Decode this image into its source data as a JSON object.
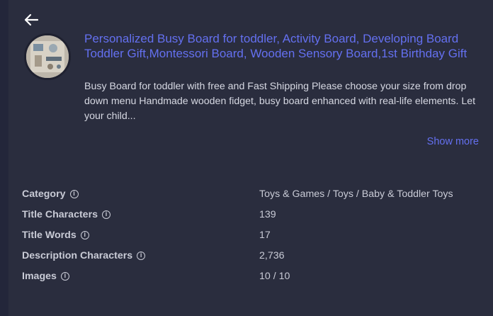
{
  "nav": {
    "back_icon": "arrow-left-icon"
  },
  "product": {
    "thumbnail": "busy-board-product-photo",
    "title": "Personalized Busy Board for toddler, Activity Board, Developing Board Toddler Gift,Montessori Board, Wooden Sensory Board,1st Birthday Gift",
    "description": "Busy Board for toddler with free and Fast Shipping Please choose your size from drop down menu Handmade wooden fidget, busy board enhanced with real-life elements. Let your child...",
    "show_more_label": "Show more"
  },
  "specs": [
    {
      "label": "Category",
      "value": "Toys & Games / Toys / Baby & Toddler Toys"
    },
    {
      "label": "Title Characters",
      "value": "139"
    },
    {
      "label": "Title Words",
      "value": "17"
    },
    {
      "label": "Description Characters",
      "value": "2,736"
    },
    {
      "label": "Images",
      "value": "10 / 10"
    }
  ],
  "colors": {
    "background": "#2a2d3e",
    "accent": "#6470f0",
    "text": "#d6d8e2"
  }
}
